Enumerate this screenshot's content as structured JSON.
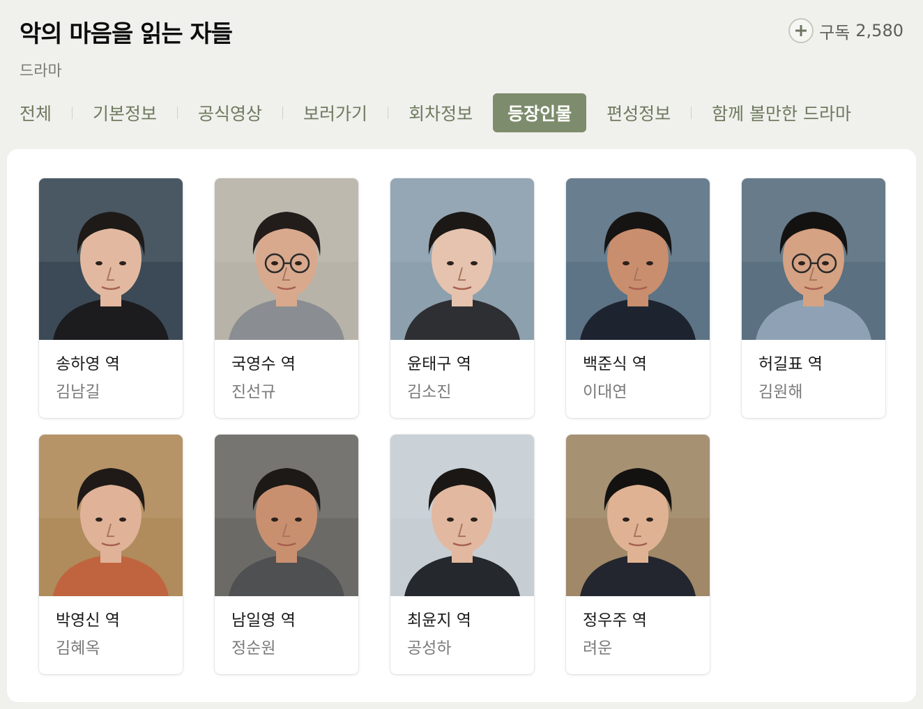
{
  "header": {
    "title": "악의 마음을 읽는 자들",
    "genre": "드라마",
    "subscribe_label": "구독",
    "subscribe_count": "2,580"
  },
  "tabs": [
    {
      "label": "전체",
      "active": false
    },
    {
      "label": "기본정보",
      "active": false
    },
    {
      "label": "공식영상",
      "active": false
    },
    {
      "label": "보러가기",
      "active": false
    },
    {
      "label": "회차정보",
      "active": false
    },
    {
      "label": "등장인물",
      "active": true
    },
    {
      "label": "편성정보",
      "active": false
    },
    {
      "label": "함께 볼만한 드라마",
      "active": false
    }
  ],
  "cast": [
    {
      "role": "송하영 역",
      "actor": "김남길",
      "bg": "#3b4a56",
      "skin": "#e2b9a0",
      "hair": "#1e1a18",
      "shirt": "#1c1c1e",
      "glasses": false
    },
    {
      "role": "국영수 역",
      "actor": "진선규",
      "bg": "#b8b3a8",
      "skin": "#d9a98e",
      "hair": "#221d1a",
      "shirt": "#8a8e92",
      "glasses": true
    },
    {
      "role": "윤태구 역",
      "actor": "김소진",
      "bg": "#8da0ae",
      "skin": "#e6c3ae",
      "hair": "#1b1816",
      "shirt": "#2e2f33",
      "glasses": false
    },
    {
      "role": "백준식 역",
      "actor": "이대연",
      "bg": "#5d7486",
      "skin": "#c98e6e",
      "hair": "#161413",
      "shirt": "#1d2430",
      "glasses": false
    },
    {
      "role": "허길표 역",
      "actor": "김원해",
      "bg": "#5b7080",
      "skin": "#d5a283",
      "hair": "#141211",
      "shirt": "#8fa2b5",
      "glasses": true
    },
    {
      "role": "박영신 역",
      "actor": "김혜옥",
      "bg": "#b08b5c",
      "skin": "#e0b298",
      "hair": "#1f1a17",
      "shirt": "#c0643f",
      "glasses": false
    },
    {
      "role": "남일영 역",
      "actor": "정순원",
      "bg": "#6c6a66",
      "skin": "#c99070",
      "hair": "#1c1916",
      "shirt": "#4e5052",
      "glasses": false
    },
    {
      "role": "최윤지 역",
      "actor": "공성하",
      "bg": "#c6ced4",
      "skin": "#e2b8a0",
      "hair": "#1a1715",
      "shirt": "#25282d",
      "glasses": false
    },
    {
      "role": "정우주 역",
      "actor": "려운",
      "bg": "#a08868",
      "skin": "#e0b294",
      "hair": "#141210",
      "shirt": "#23262e",
      "glasses": false
    }
  ]
}
